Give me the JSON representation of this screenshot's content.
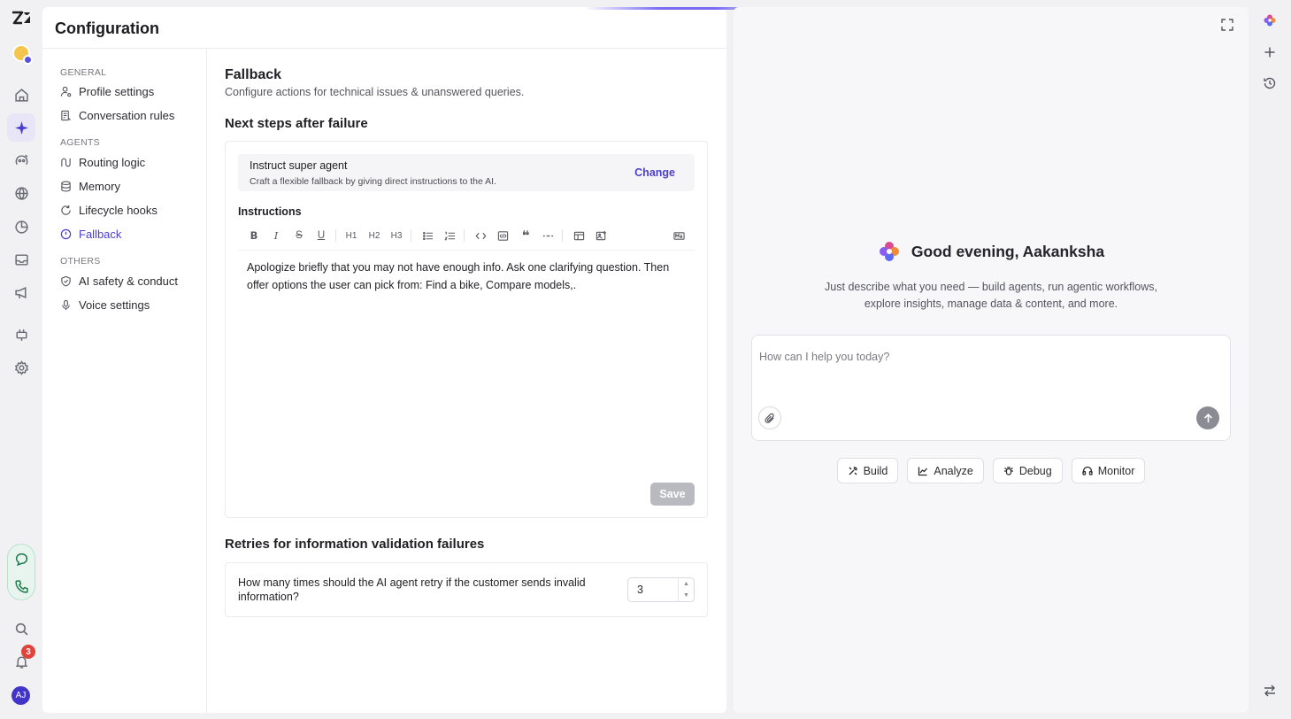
{
  "panel": {
    "title": "Configuration"
  },
  "subnav": {
    "groups": [
      {
        "label": "GENERAL",
        "items": [
          {
            "label": "Profile settings",
            "icon": "user-gear-icon"
          },
          {
            "label": "Conversation rules",
            "icon": "rules-doc-icon"
          }
        ]
      },
      {
        "label": "AGENTS",
        "items": [
          {
            "label": "Routing logic",
            "icon": "routing-icon"
          },
          {
            "label": "Memory",
            "icon": "database-icon"
          },
          {
            "label": "Lifecycle hooks",
            "icon": "refresh-icon"
          },
          {
            "label": "Fallback",
            "icon": "info-circle-icon",
            "active": true
          }
        ]
      },
      {
        "label": "OTHERS",
        "items": [
          {
            "label": "AI safety & conduct",
            "icon": "shield-check-icon"
          },
          {
            "label": "Voice settings",
            "icon": "microphone-icon"
          }
        ]
      }
    ]
  },
  "fallback": {
    "title": "Fallback",
    "subtitle": "Configure actions for technical issues & unanswered queries.",
    "next_steps_heading": "Next steps after failure",
    "agent_title": "Instruct super agent",
    "agent_desc": "Craft a flexible fallback by giving direct instructions to the AI.",
    "change_label": "Change",
    "instructions_label": "Instructions",
    "toolbar": {
      "h1": "H1",
      "h2": "H2",
      "h3": "H3"
    },
    "instructions_text": "Apologize briefly that you may not have enough info. Ask one clarifying question. Then offer options the user can pick from: Find a bike, Compare models,.",
    "save_label": "Save",
    "retries_heading": "Retries for information validation failures",
    "retry_question": "How many times should the AI agent retry if the customer sends invalid information?",
    "retry_value": "3"
  },
  "assistant": {
    "greeting": "Good evening, Aakanksha",
    "subtitle": "Just describe what you need — build agents, run agentic workflows, explore insights, manage data & content, and more.",
    "placeholder": "How can I help you today?",
    "chips": [
      {
        "label": "Build",
        "icon": "tools-icon"
      },
      {
        "label": "Analyze",
        "icon": "chart-line-icon"
      },
      {
        "label": "Debug",
        "icon": "bug-icon"
      },
      {
        "label": "Monitor",
        "icon": "headset-icon"
      }
    ]
  },
  "rail": {
    "notification_count": "3",
    "user_initials": "AJ"
  },
  "colors": {
    "accent": "#4a3fd0",
    "save_disabled": "#b9b9c0",
    "voice_pill": "#e7f5ee",
    "badge": "#e0433b"
  }
}
